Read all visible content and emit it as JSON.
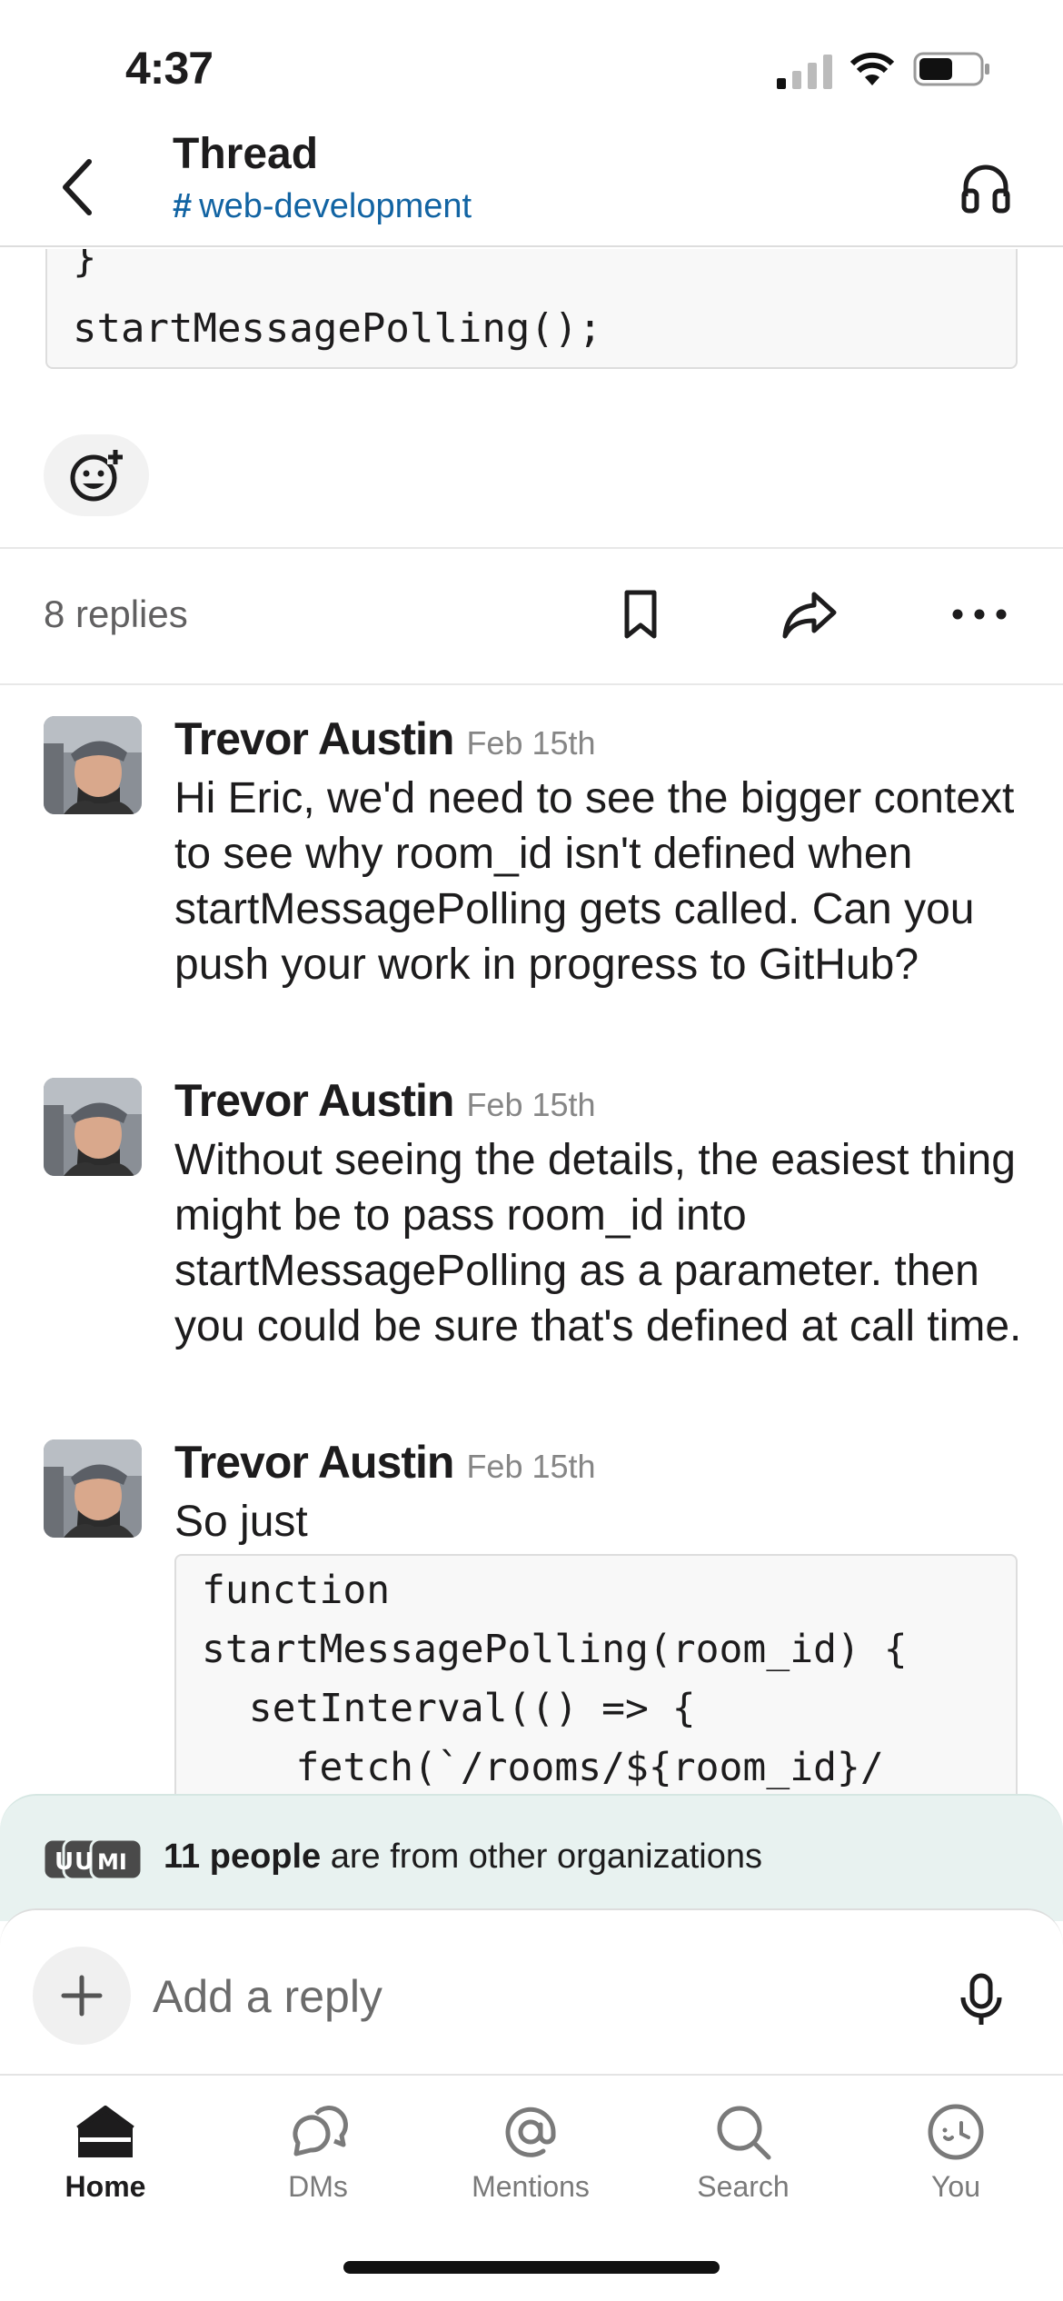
{
  "status_bar": {
    "time": "4:37"
  },
  "header": {
    "title": "Thread",
    "channel_hash": "#",
    "channel": "web-development"
  },
  "parent_message": {
    "code_lines": [
      "}",
      "startMessagePolling();"
    ]
  },
  "replies_bar": {
    "count_label": "8 replies"
  },
  "messages": [
    {
      "author": "Trevor Austin",
      "timestamp": "Feb 15th",
      "text": "Hi Eric, we'd need to see the bigger context to see why room_id isn't defined when startMessagePolling gets called. Can you push your work in progress to GitHub?"
    },
    {
      "author": "Trevor Austin",
      "timestamp": "Feb 15th",
      "text": "Without seeing the details, the easiest thing might be to pass room_id into startMessagePolling as a parameter. then you could be sure that's defined at call time."
    },
    {
      "author": "Trevor Austin",
      "timestamp": "Feb 15th",
      "text": "So just",
      "code": "function\nstartMessagePolling(room_id) {\n  setInterval(() => {\n    fetch(`/rooms/${room_id}/\nmessages`, {"
    }
  ],
  "org_banner": {
    "count": "11 people",
    "rest": "are from other organizations",
    "avatar_letters": [
      "U",
      "U",
      "MI"
    ]
  },
  "composer": {
    "placeholder": "Add a reply"
  },
  "tabs": [
    {
      "label": "Home",
      "icon": "home-icon",
      "active": true
    },
    {
      "label": "DMs",
      "icon": "dms-icon",
      "active": false
    },
    {
      "label": "Mentions",
      "icon": "mentions-icon",
      "active": false
    },
    {
      "label": "Search",
      "icon": "search-icon",
      "active": false
    },
    {
      "label": "You",
      "icon": "you-icon",
      "active": false
    }
  ],
  "colors": {
    "link": "#1264a3",
    "banner": "#e8f2f0",
    "text": "#1d1c1d",
    "muted": "#616061"
  }
}
